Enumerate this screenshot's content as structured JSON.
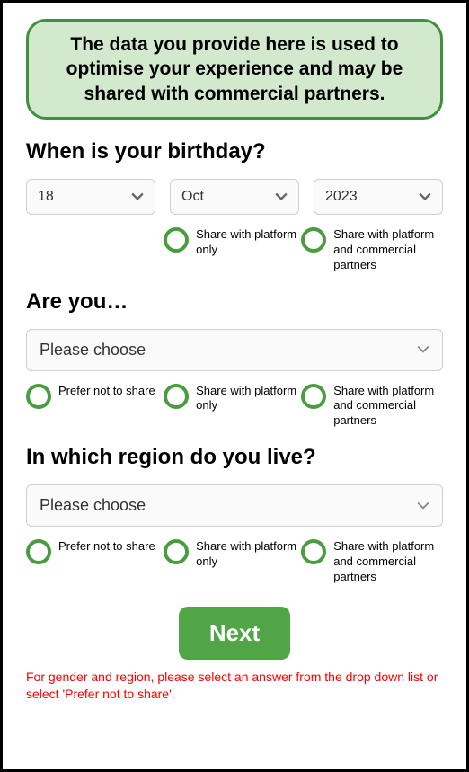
{
  "notice": "The data you provide here is used to optimise your experience and may be shared with commercial partners.",
  "birthday": {
    "question": "When is your birthday?",
    "day": "18",
    "month": "Oct",
    "year": "2023",
    "share_platform": "Share with platform only",
    "share_all": "Share with platform and commercial partners"
  },
  "gender": {
    "question": "Are you…",
    "placeholder": "Please choose",
    "prefer_not": "Prefer not to share",
    "share_platform": "Share with platform only",
    "share_all": "Share with platform and commercial partners"
  },
  "region": {
    "question": "In which region do you live?",
    "placeholder": "Please choose",
    "prefer_not": "Prefer not to share",
    "share_platform": "Share with platform only",
    "share_all": "Share with platform and commercial partners"
  },
  "next_label": "Next",
  "error": "For gender and region, please select an answer from the drop down list or select 'Prefer not to share'."
}
